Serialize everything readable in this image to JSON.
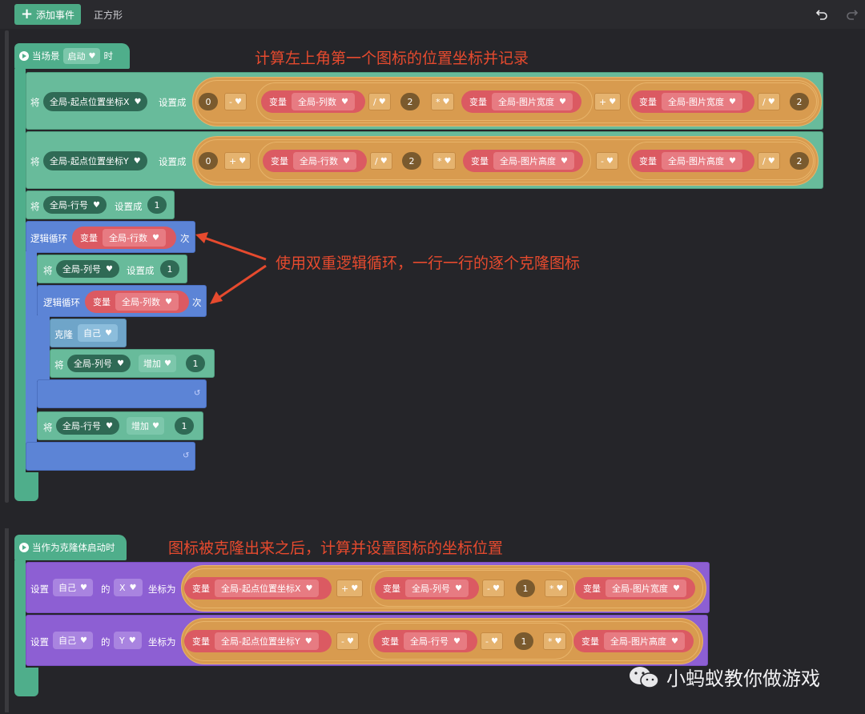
{
  "toolbar": {
    "add_event_label": "添加事件",
    "sprite_name": "正方形",
    "undo_icon": "undo-icon",
    "redo_icon": "redo-icon"
  },
  "colors": {
    "event_green": "#4fae8b",
    "action_green": "#68bb9b",
    "loop_blue": "#5c84d6",
    "motion_purple": "#8d5fd3",
    "operator_orange": "#d89b4f",
    "variable_red": "#db5a62",
    "annotation_red": "#e64a2e"
  },
  "script1": {
    "hat_prefix": "当场景",
    "hat_dropdown": "启动",
    "hat_suffix": "时",
    "set_x": {
      "kw": "将",
      "var": "全局-起点位置坐标X",
      "setto": "设置成",
      "n0": "0",
      "op_minus": "-",
      "var_kw": "变量",
      "var_cols": "全局-列数",
      "div": "/",
      "n2": "2",
      "mul": "*",
      "var_imgw": "全局-图片宽度",
      "plus": "+",
      "var_imgw2": "全局-图片宽度",
      "div2": "/",
      "n2b": "2"
    },
    "set_y": {
      "kw": "将",
      "var": "全局-起点位置坐标Y",
      "setto": "设置成",
      "n0": "0",
      "op_plus": "+",
      "var_kw": "变量",
      "var_rows": "全局-行数",
      "div": "/",
      "n2": "2",
      "mul": "*",
      "var_imgh": "全局-图片高度",
      "minus": "-",
      "var_imgh2": "全局-图片高度",
      "div2": "/",
      "n2b": "2"
    },
    "set_row": {
      "kw": "将",
      "var": "全局-行号",
      "setto": "设置成",
      "val": "1"
    },
    "loop1": {
      "kw": "逻辑循环",
      "var_kw": "变量",
      "var": "全局-行数",
      "times": "次"
    },
    "set_col": {
      "kw": "将",
      "var": "全局-列号",
      "setto": "设置成",
      "val": "1"
    },
    "loop2": {
      "kw": "逻辑循环",
      "var_kw": "变量",
      "var": "全局-列数",
      "times": "次"
    },
    "clone": {
      "kw": "克隆",
      "target": "自己"
    },
    "inc_col": {
      "kw": "将",
      "var": "全局-列号",
      "action": "增加",
      "val": "1"
    },
    "inc_row": {
      "kw": "将",
      "var": "全局-行号",
      "action": "增加",
      "val": "1"
    }
  },
  "script2": {
    "hat": "当作为克隆体启动时",
    "set_x": {
      "kw": "设置",
      "target": "自己",
      "of": "的",
      "axis": "X",
      "coord": "坐标为",
      "var_kw": "变量",
      "var_start": "全局-起点位置坐标X",
      "plus": "+",
      "var_col": "全局-列号",
      "minus": "-",
      "n1": "1",
      "mul": "*",
      "var_imgw": "全局-图片宽度"
    },
    "set_y": {
      "kw": "设置",
      "target": "自己",
      "of": "的",
      "axis": "Y",
      "coord": "坐标为",
      "var_kw": "变量",
      "var_start": "全局-起点位置坐标Y",
      "minus": "-",
      "var_row": "全局-行号",
      "minus2": "-",
      "n1": "1",
      "mul": "*",
      "var_imgh": "全局-图片高度"
    }
  },
  "annotations": {
    "a1": "计算左上角第一个图标的位置坐标并记录",
    "a2": "使用双重逻辑循环，一行一行的逐个克隆图标",
    "a3": "图标被克隆出来之后，计算并设置图标的坐标位置"
  },
  "watermark": "小蚂蚁教你做游戏"
}
